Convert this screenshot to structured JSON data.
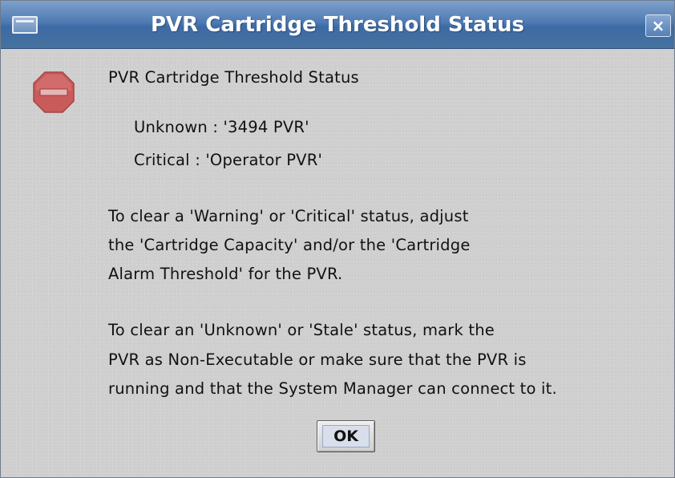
{
  "window": {
    "title": "PVR Cartridge Threshold Status",
    "close_glyph": "×",
    "menu_icon": "window-menu-icon"
  },
  "dialog": {
    "icon": "stop-icon",
    "heading": "PVR Cartridge Threshold Status",
    "status_lines": [
      "Unknown : '3494 PVR'",
      "Critical : 'Operator PVR'"
    ],
    "paragraph1": [
      "To clear a 'Warning' or 'Critical' status, adjust",
      "the 'Cartridge Capacity' and/or the 'Cartridge",
      "Alarm Threshold' for the PVR."
    ],
    "paragraph2": [
      "To clear an 'Unknown' or 'Stale' status, mark the",
      "PVR as Non-Executable or make sure that the PVR is",
      "running and that the System Manager can connect to it."
    ],
    "ok_label": "OK"
  },
  "colors": {
    "titlebar": "#4f7bb3",
    "stop_icon": "#c85a5a",
    "background": "#d0d0d0"
  }
}
